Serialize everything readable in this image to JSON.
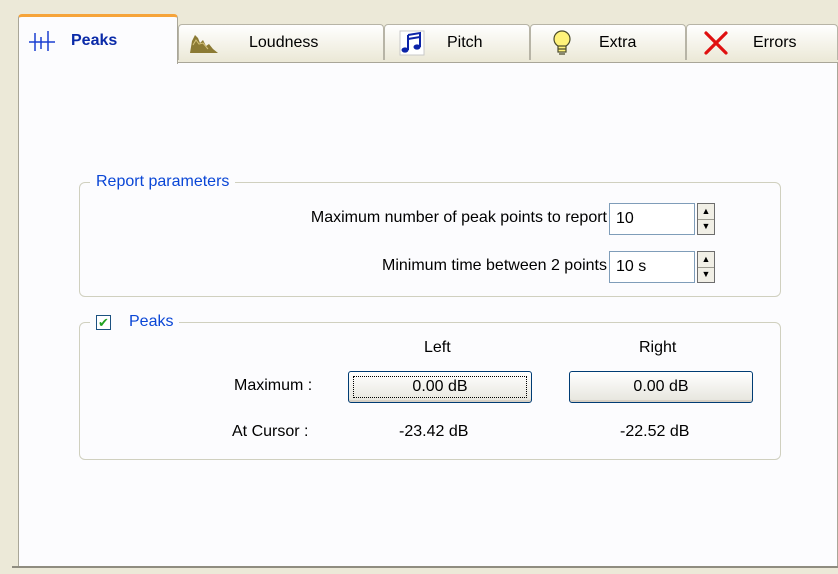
{
  "tabs": [
    {
      "label": "Peaks",
      "icon": "peaks-icon",
      "active": true
    },
    {
      "label": "Loudness",
      "icon": "loudness-icon",
      "active": false
    },
    {
      "label": "Pitch",
      "icon": "music-note-icon",
      "active": false
    },
    {
      "label": "Extra",
      "icon": "lightbulb-icon",
      "active": false
    },
    {
      "label": "Errors",
      "icon": "red-x-icon",
      "active": false
    }
  ],
  "report": {
    "legend": "Report parameters",
    "max_points_label": "Maximum number of peak points to report",
    "max_points_value": "10",
    "min_time_label": "Minimum time between 2 points",
    "min_time_value": "10 s"
  },
  "peaks": {
    "legend": "Peaks",
    "enabled": true,
    "checkmark": "✔",
    "left_header": "Left",
    "right_header": "Right",
    "maximum_label": "Maximum :",
    "at_cursor_label": "At Cursor :",
    "left_maximum": "0.00 dB",
    "right_maximum": "0.00 dB",
    "left_cursor": "-23.42 dB",
    "right_cursor": "-22.52 dB"
  },
  "colors": {
    "accent_tab": "#f6a43a",
    "legend_text": "#0a46d6",
    "active_tab_text": "#0a2aa8",
    "check_green": "#21a121",
    "error_red": "#e01010"
  }
}
